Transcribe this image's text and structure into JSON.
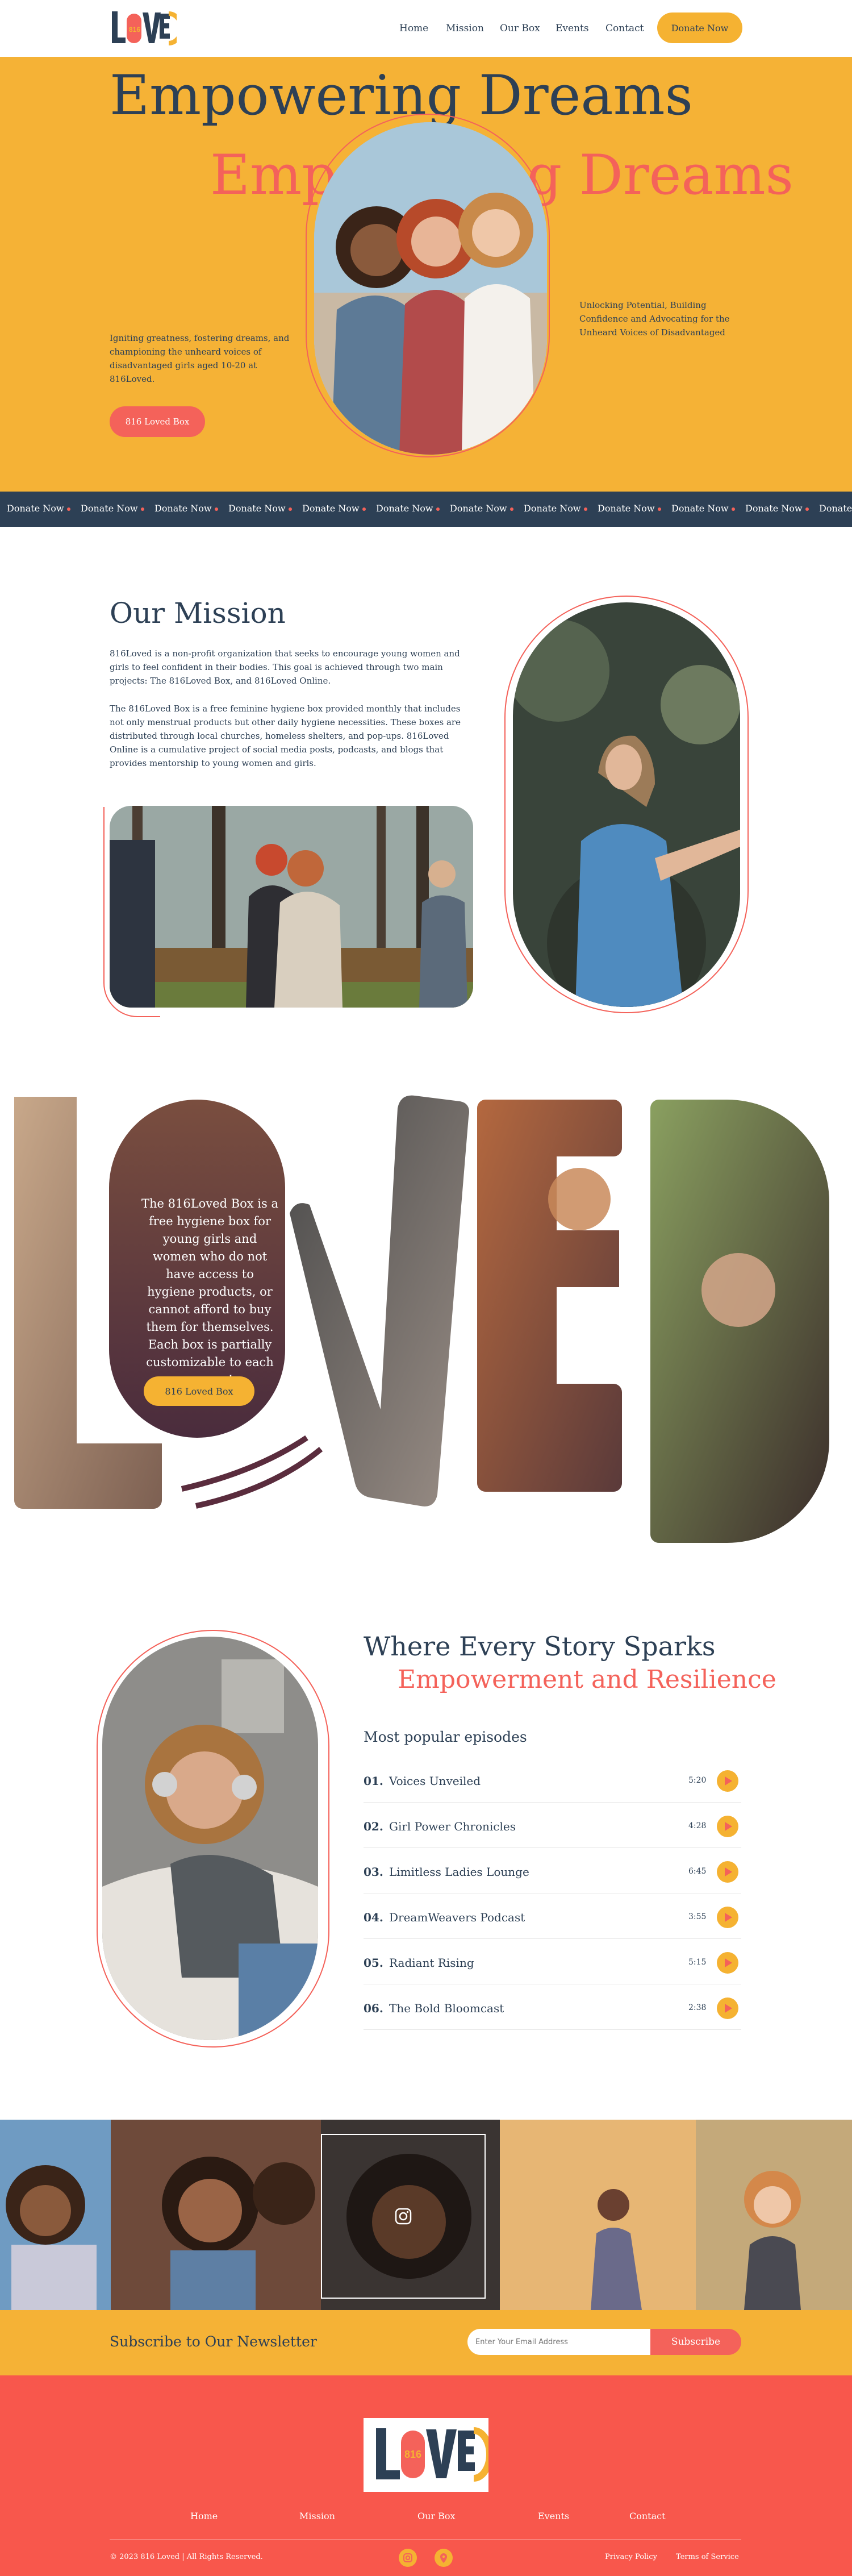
{
  "header": {
    "logo_text": "LOVED",
    "nav": [
      "Home",
      "Mission",
      "Our Box",
      "Events",
      "Contact"
    ],
    "donate_label": "Donate Now"
  },
  "hero": {
    "title_line1": "Empowering Dreams",
    "title_line2": "Empowering Dreams",
    "description": "Igniting greatness, fostering dreams, and championing the unheard voices of disadvantaged girls aged 10-20 at 816Loved.",
    "button_label": "816 Loved Box",
    "right_text": "Unlocking Potential, Building Confidence and Advocating for the Unheard Voices of Disadvantaged"
  },
  "ticker": {
    "label": "Donate Now",
    "count": 12
  },
  "mission": {
    "title": "Our Mission",
    "p1": "816Loved is a non-profit organization that seeks to encourage young women and girls to feel confident in their bodies. This goal is achieved through two main projects: The 816Loved Box, and 816Loved Online.",
    "p2": "The 816Loved Box is a free feminine hygiene box provided monthly that includes not only menstrual products but other daily hygiene necessities. These boxes are distributed through local churches, homeless shelters, and pop-ups. 816Loved Online is a cumulative project of social media posts, podcasts, and blogs that provides mentorship to young women and girls."
  },
  "loved_box": {
    "text": "The 816Loved Box is a free hygiene box for young girls and women who do not have access to hygiene products, or cannot afford to buy them for themselves. Each box is partially customizable to each person!",
    "button_label": "816 Loved Box"
  },
  "podcast": {
    "title_line1": "Where Every Story Sparks",
    "title_line2": "Empowerment and Resilience",
    "subtitle": "Most popular episodes",
    "episodes": [
      {
        "num": "01.",
        "name": "Voices Unveiled",
        "dur": "5:20"
      },
      {
        "num": "02.",
        "name": "Girl Power Chronicles",
        "dur": "4:28"
      },
      {
        "num": "03.",
        "name": "Limitless Ladies Lounge",
        "dur": "6:45"
      },
      {
        "num": "04.",
        "name": "DreamWeavers Podcast",
        "dur": "3:55"
      },
      {
        "num": "05.",
        "name": "Radiant Rising",
        "dur": "5:15"
      },
      {
        "num": "06.",
        "name": "The Bold Bloomcast",
        "dur": "2:38"
      }
    ]
  },
  "newsletter": {
    "title": "Subscribe to Our Newsletter",
    "placeholder": "Enter Your Email Address",
    "button_label": "Subscribe"
  },
  "footer": {
    "logo_text": "LOVED",
    "nav": [
      "Home",
      "Mission",
      "Our Box",
      "Events",
      "Contact"
    ],
    "copyright": "© 2023 816 Loved  |  All Rights Reserved.",
    "privacy": "Privacy Policy",
    "terms": "Terms of Service"
  },
  "colors": {
    "navy": "#2d4055",
    "orange": "#f5b236",
    "coral": "#f4625a",
    "footer_red": "#f8574c"
  }
}
